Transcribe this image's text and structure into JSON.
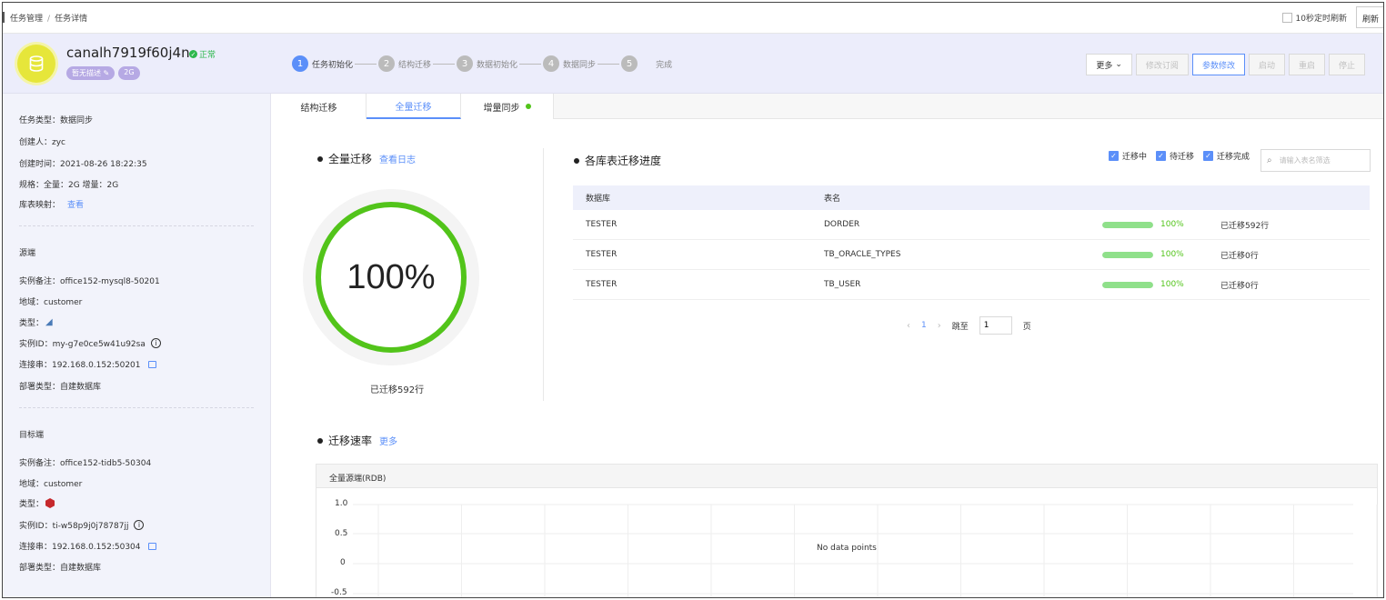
{
  "breadcrumb": {
    "first": "任务管理",
    "sep": "/",
    "second": "任务详情"
  },
  "topbar": {
    "auto_refresh": "10秒定时刷新",
    "refresh": "刷新"
  },
  "task": {
    "name": "canalh7919f60j4n",
    "status": "正常",
    "tags": [
      "暂无描述",
      "2G"
    ]
  },
  "steps": [
    {
      "num": "1",
      "label": "任务初始化"
    },
    {
      "num": "2",
      "label": "结构迁移"
    },
    {
      "num": "3",
      "label": "数据初始化"
    },
    {
      "num": "4",
      "label": "数据同步"
    },
    {
      "num": "5",
      "label": "完成"
    }
  ],
  "actions": {
    "more": "更多",
    "modify_sub": "修改订阅",
    "param_modify": "参数修改",
    "start": "启动",
    "restart": "重启",
    "stop": "停止"
  },
  "sidebar": {
    "task_type": "任务类型：数据同步",
    "creator": "创建人：zyc",
    "created_time": "创建时间：2021-08-26 18:22:35",
    "spec": "规格：全量：2G 增量：2G",
    "mapping_label": "库表映射：",
    "mapping_link": "查看",
    "source_title": "源端",
    "source": {
      "remark": "实例备注：office152-mysql8-50201",
      "region": "地域：customer",
      "type": "类型：",
      "instance": "实例ID：my-g7e0ce5w41u92sa",
      "conn": "连接串：192.168.0.152:50201",
      "deploy": "部署类型：自建数据库"
    },
    "target_title": "目标端",
    "target": {
      "remark": "实例备注：office152-tidb5-50304",
      "region": "地域：customer",
      "type": "类型：",
      "instance": "实例ID：ti-w58p9j0j78787jj",
      "conn": "连接串：192.168.0.152:50304",
      "deploy": "部署类型：自建数据库"
    }
  },
  "tabs": [
    "结构迁移",
    "全量迁移",
    "增量同步"
  ],
  "full": {
    "title": "全量迁移",
    "log_link": "查看日志",
    "percent": "100%",
    "migrated": "已迁移592行"
  },
  "progress": {
    "title": "各库表迁移进度",
    "filters": [
      "迁移中",
      "待迁移",
      "迁移完成"
    ],
    "search_placeholder": "请输入表名筛选",
    "headers": [
      "数据库",
      "表名"
    ],
    "rows": [
      {
        "db": "TESTER",
        "table": "DORDER",
        "pct": "100%",
        "fill": 100,
        "rows": "已迁移592行"
      },
      {
        "db": "TESTER",
        "table": "TB_ORACLE_TYPES",
        "pct": "100%",
        "fill": 100,
        "rows": "已迁移0行"
      },
      {
        "db": "TESTER",
        "table": "TB_USER",
        "pct": "100%",
        "fill": 100,
        "rows": "已迁移0行"
      }
    ]
  },
  "pager": {
    "page": "1",
    "goto": "跳至",
    "input": "1",
    "suffix": "页"
  },
  "rate": {
    "title": "迁移速率",
    "more": "更多",
    "chart_title": "全量源端(RDB)",
    "nodata": "No data points",
    "yticks": [
      "1.0",
      "0.5",
      "0",
      "-0.5"
    ]
  },
  "colors": {
    "accent": "#5b8ff9",
    "success": "#52c41a",
    "header_bg": "#ecedfb"
  }
}
